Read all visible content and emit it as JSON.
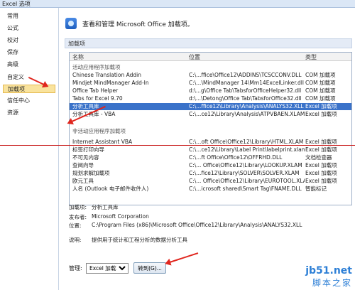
{
  "window": {
    "title": "Excel 选项"
  },
  "sidebar": {
    "items": [
      {
        "label": "常用"
      },
      {
        "label": "公式"
      },
      {
        "label": "校对"
      },
      {
        "label": "保存"
      },
      {
        "label": "高级"
      },
      {
        "label": "自定义"
      },
      {
        "label": "加载项",
        "active": true
      },
      {
        "label": "信任中心"
      },
      {
        "label": "资源"
      }
    ]
  },
  "header": {
    "title": "查看和管理 Microsoft Office 加载项。"
  },
  "section": {
    "title": "加载项"
  },
  "table": {
    "columns": [
      "名称",
      "位置",
      "类型"
    ],
    "groups": [
      {
        "title": "活动应用程序加载项",
        "rows": [
          {
            "name": "Chinese Translation Addin",
            "location": "C:\\...ffice\\Office12\\ADDINS\\TCSCCONV.DLL",
            "type": "COM 加载项"
          },
          {
            "name": "Mindjet MindManager Add-In",
            "location": "C:\\...\\MindManager 14\\Mm14ExcelLinker.dll",
            "type": "COM 加载项"
          },
          {
            "name": "Office Tab Helper",
            "location": "d:\\...g\\Office Tab\\TabsforOfficeHelper32.dll",
            "type": "COM 加载项"
          },
          {
            "name": "Tabs for Excel 9.70",
            "location": "d:\\...\\Detong\\Office Tab\\TabsforOffice32.dll",
            "type": "COM 加载项"
          },
          {
            "name": "分析工具库",
            "location": "C:\\...ffice12\\Library\\Analysis\\ANALYS32.XLL",
            "type": "Excel 加载项",
            "selected": true
          },
          {
            "name": "分析工具库 - VBA",
            "location": "C:\\...ce12\\Library\\Analysis\\ATPVBAEN.XLAM",
            "type": "Excel 加载项"
          }
        ]
      },
      {
        "title": "非活动应用程序加载项",
        "rows": [
          {
            "name": "Internet Assistant VBA",
            "location": "C:\\...oft Office\\Office12\\Library\\HTML.XLAM",
            "type": "Excel 加载项"
          },
          {
            "name": "标签打印向导",
            "location": "C:\\...ce12\\Library\\Label Print\\labelprint.xlam",
            "type": "Excel 加载项"
          },
          {
            "name": "不可见内容",
            "location": "C:\\...ft Office\\Office12\\OFFRHD.DLL",
            "type": "文档检查器"
          },
          {
            "name": "查阅向导",
            "location": "C:\\... Office\\Office12\\Library\\LOOKUP.XLAM",
            "type": "Excel 加载项"
          },
          {
            "name": "规划求解加载项",
            "location": "C:\\...fice12\\Library\\SOLVER\\SOLVER.XLAM",
            "type": "Excel 加载项"
          },
          {
            "name": "欧元工具",
            "location": "C:\\... Office\\Office12\\Library\\EUROTOOL.XLAM",
            "type": "Excel 加载项"
          },
          {
            "name": "人名 (Outlook 电子邮件收件人)",
            "location": "C:\\...icrosoft shared\\Smart Tag\\FNAME.DLL",
            "type": "智能标记"
          }
        ]
      }
    ]
  },
  "details": {
    "addin_label": "加载项:",
    "addin_value": "分析工具库",
    "publisher_label": "发布者:",
    "publisher_value": "Microsoft Corporation",
    "location_label": "位置:",
    "location_value": "C:\\Program Files (x86)\\Microsoft Office\\Office12\\Library\\Analysis\\ANALYS32.XLL",
    "desc_label": "说明:",
    "desc_value": "提供用于统计和工程分析的数据分析工具"
  },
  "manage": {
    "label": "管理:",
    "selected": "Excel 加载项",
    "go_label": "转到(G)..."
  },
  "watermark": {
    "line1": "jb51.net",
    "line2": "脚本之家"
  },
  "colors": {
    "selected_row": "#3a72c9",
    "annotation_red": "#e0261e",
    "active_side": "#f9e39d"
  }
}
